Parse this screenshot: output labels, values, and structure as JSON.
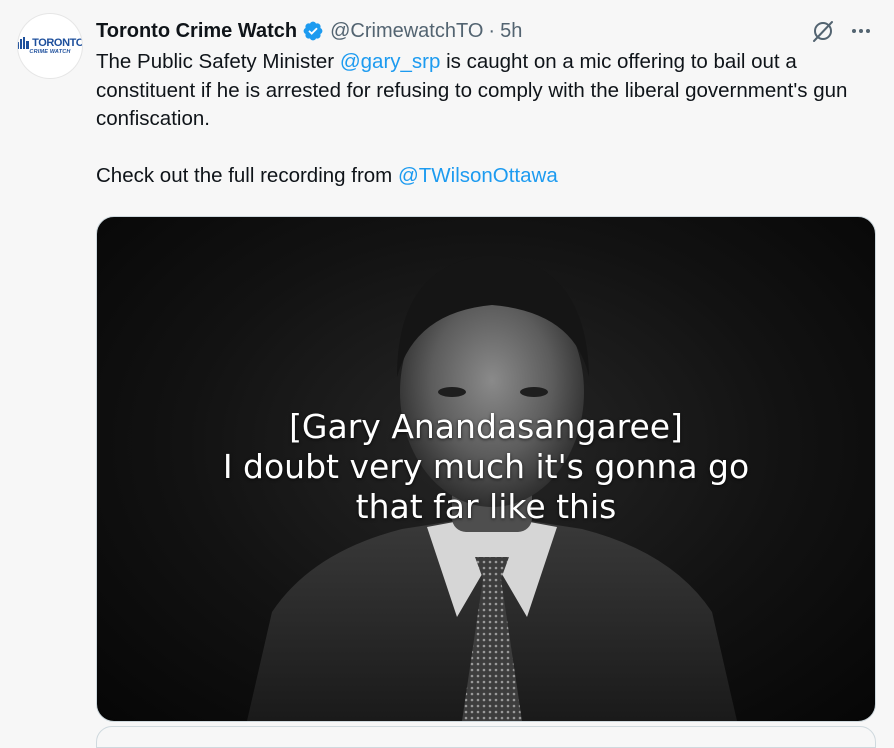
{
  "author": {
    "avatar_word": "TORONTO",
    "avatar_sub": "CRIME WATCH",
    "display_name": "Toronto Crime Watch",
    "handle": "@CrimewatchTO",
    "separator": "·",
    "time": "5h",
    "verified_color": "#1d9bf0"
  },
  "tweet": {
    "line1_prefix": "The Public Safety Minister ",
    "mention1": "@gary_srp",
    "line1_suffix": " is caught on a mic offering to bail out a constituent if he is arrested for refusing to comply with the liberal government's gun confiscation.",
    "line2_prefix": "Check out the full recording from ",
    "mention2": "@TWilsonOttawa"
  },
  "media": {
    "caption_line1": "[Gary Anandasangaree]",
    "caption_line2": "I doubt very much it's gonna go",
    "caption_line3": "that far like this"
  },
  "icons": {
    "verified": "verified-badge-icon",
    "grok": "grok-icon",
    "more": "more-icon"
  },
  "colors": {
    "link": "#1d9bf0",
    "text": "#0f1419",
    "secondary": "#536471"
  }
}
